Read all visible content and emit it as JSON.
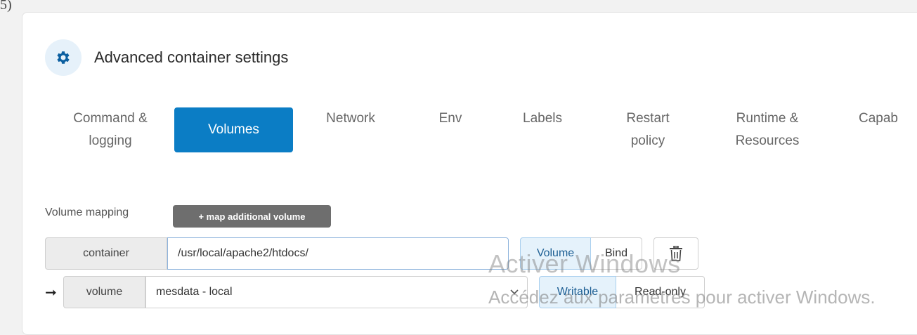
{
  "corner_mark": "5)",
  "panel": {
    "title": "Advanced container settings",
    "icon": "gear-icon"
  },
  "tabs": [
    {
      "line1": "Command &",
      "line2": "logging",
      "active": false
    },
    {
      "line1": "Volumes",
      "line2": "",
      "active": true
    },
    {
      "line1": "Network",
      "line2": "",
      "active": false
    },
    {
      "line1": "Env",
      "line2": "",
      "active": false
    },
    {
      "line1": "Labels",
      "line2": "",
      "active": false
    },
    {
      "line1": "Restart",
      "line2": "policy",
      "active": false
    },
    {
      "line1": "Runtime &",
      "line2": "Resources",
      "active": false
    },
    {
      "line1": "Capab",
      "line2": "",
      "active": false
    }
  ],
  "volume_mapping": {
    "label": "Volume mapping",
    "add_button": "+ map additional volume",
    "container": {
      "addon": "container",
      "value": "/usr/local/apache2/htdocs/",
      "type_options": [
        "Volume",
        "Bind"
      ],
      "selected_type": "Volume"
    },
    "volume": {
      "arrow": "➞",
      "addon": "volume",
      "selected": "mesdata - local",
      "mode_options": [
        "Writable",
        "Read-only"
      ],
      "selected_mode": "Writable"
    }
  },
  "watermark": {
    "line1": "Activer Windows",
    "line2": "Accédez aux paramètres pour activer Windows."
  },
  "colors": {
    "accent": "#0b7dc5",
    "map_button": "#6e6e6e"
  }
}
